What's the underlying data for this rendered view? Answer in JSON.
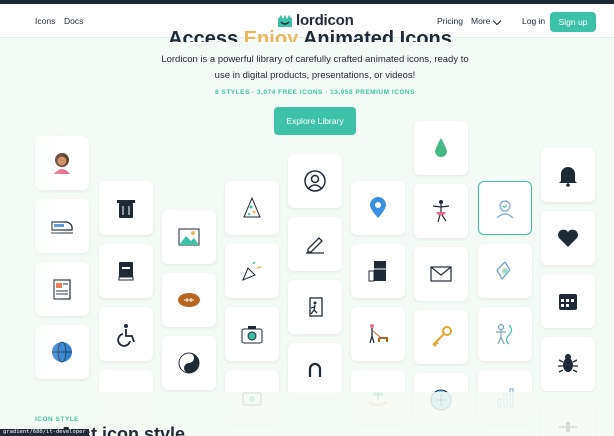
{
  "nav": {
    "icons": "Icons",
    "docs": "Docs",
    "brand": "lordicon",
    "pricing": "Pricing",
    "more": "More",
    "login": "Log in",
    "signup": "Sign up"
  },
  "hero": {
    "title_start": "Access",
    "title_highlight": "Enjoy",
    "title_end": "Animated Icons",
    "subtitle": "Lordicon is a powerful library of carefully crafted animated icons, ready to use in digital products, presentations, or videos!",
    "stats": "6 STYLES · 3,074 FREE ICONS · 13,958 PREMIUM ICONS",
    "cta": "Explore Library"
  },
  "section": {
    "label": "ICON STYLE",
    "title": "Just icon style"
  },
  "tooltip": "gradient/680/it-developer",
  "colors": {
    "accent": "#3ec2a7",
    "highlight": "#eab85c",
    "dark": "#1f2a37"
  },
  "icons": [
    "person-avatar-icon",
    "train-icon",
    "newspaper-icon",
    "globe-icon",
    "trash-icon",
    "book-icon",
    "wheelchair-icon",
    "landscape-image-icon",
    "football-icon",
    "yin-yang-icon",
    "party-hat-icon",
    "party-popper-icon",
    "camera-icon",
    "photo-camera-icon",
    "user-circle-icon",
    "edit-pencil-icon",
    "exit-door-icon",
    "magnet-icon",
    "location-pin-icon",
    "fridge-icon",
    "dog-walk-icon",
    "plant-hands-icon",
    "pear-icon",
    "ballerina-icon",
    "mail-icon",
    "key-icon",
    "compass-icon",
    "it-developer-icon",
    "recycle-icon",
    "dna-scientist-icon",
    "bar-chart-icon",
    "bell-icon",
    "heart-icon",
    "calendar-icon",
    "bug-icon",
    "slider-icon"
  ]
}
